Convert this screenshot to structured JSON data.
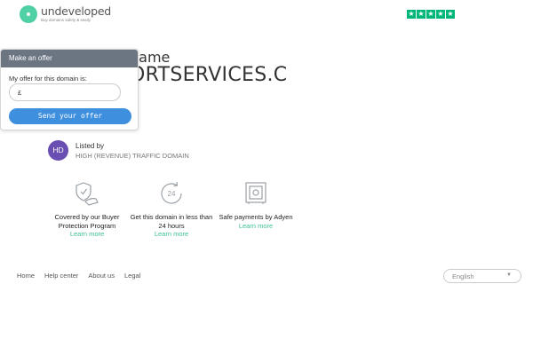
{
  "header": {
    "logo_name": "undeveloped",
    "logo_tagline": "Buy domains safely & easily",
    "rating_stars": 5
  },
  "domain": {
    "label": "name",
    "name": "ORTSERVICES.C"
  },
  "offer": {
    "title": "Make an offer",
    "field_label": "My offer for this domain is:",
    "currency": "£",
    "input_value": "",
    "button_label": "Send your offer"
  },
  "listing": {
    "avatar_initials": "HD",
    "title": "Listed by",
    "subtitle": "HIGH (REVENUE) TRAFFIC DOMAIN"
  },
  "features": [
    {
      "icon": "shield-hand-icon",
      "title": "Covered by our Buyer Protection Program",
      "link": "Learn more"
    },
    {
      "icon": "clock-24-icon",
      "title": "Get this domain in less than 24 hours",
      "link": "Learn more"
    },
    {
      "icon": "safe-icon",
      "title": "Safe payments by Adyen",
      "link": "Learn more"
    }
  ],
  "footer": {
    "links": [
      "Home",
      "Help center",
      "About us",
      "Legal"
    ],
    "language": "English"
  },
  "colors": {
    "brand": "#4fd1a5",
    "trustpilot": "#00b67a",
    "offer_header": "#6c7683",
    "button": "#3f8fdf",
    "avatar": "#6a4fb3",
    "link": "#3dbf9a"
  }
}
